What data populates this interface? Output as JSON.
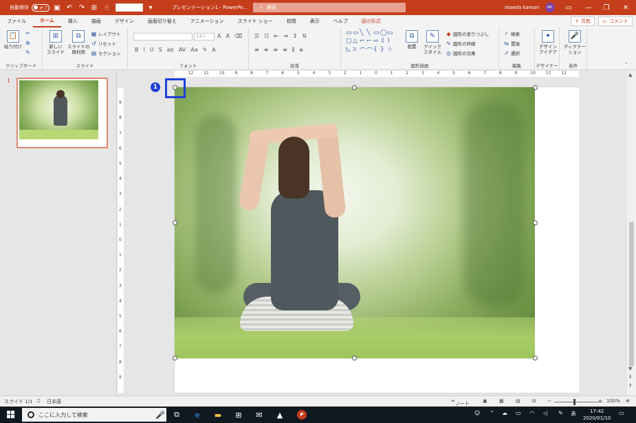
{
  "titlebar": {
    "autosave_label": "自動保存",
    "autosave_state": "オフ",
    "doc_title": "プレゼンテーション1 - PowerPo...",
    "search_placeholder": "検索",
    "user_name": "maeda kamari",
    "user_initials": "MK"
  },
  "tabs": [
    "ファイル",
    "ホーム",
    "挿入",
    "描画",
    "デザイン",
    "画面切り替え",
    "アニメーション",
    "スライド ショー",
    "校閲",
    "表示",
    "ヘルプ",
    "図の形式"
  ],
  "active_tab": "ホーム",
  "share": {
    "share_label": "共有",
    "comment_label": "コメント"
  },
  "ribbon": {
    "clipboard": {
      "group": "クリップボード",
      "paste": "貼り付け"
    },
    "slides": {
      "group": "スライド",
      "new_slide": "新しい\nスライド",
      "reuse": "スライドの\n再利用",
      "layout": "レイアウト",
      "reset": "リセット",
      "section": "セクション"
    },
    "font": {
      "group": "フォント",
      "size": "24+"
    },
    "paragraph": {
      "group": "段落"
    },
    "drawing": {
      "group": "図形描画",
      "arrange": "配置",
      "quick_style": "クイック\nスタイル",
      "fill": "図形の塗りつぶし",
      "outline": "図形の枠線",
      "effect": "図形の効果"
    },
    "editing": {
      "group": "編集",
      "find": "検索",
      "replace": "置換",
      "select": "選択"
    },
    "designer": {
      "group": "デザイナー",
      "ideas": "デザイン\nアイデア"
    },
    "voice": {
      "group": "音声",
      "dictate": "ディクテー\nション"
    }
  },
  "thumbnail": {
    "number": "1"
  },
  "callout": {
    "number": "1"
  },
  "ruler": {
    "h_ticks": [
      "12",
      "11",
      "10",
      "9",
      "8",
      "7",
      "6",
      "5",
      "4",
      "3",
      "2",
      "1",
      "0",
      "1",
      "2",
      "3",
      "4",
      "5",
      "6",
      "7",
      "8",
      "9",
      "10",
      "11",
      "12"
    ],
    "v_ticks": [
      "9",
      "8",
      "7",
      "6",
      "5",
      "4",
      "3",
      "2",
      "1",
      "0",
      "1",
      "2",
      "3",
      "4",
      "5",
      "6",
      "7",
      "8",
      "9"
    ]
  },
  "status": {
    "slide_info": "スライド 1/1",
    "language": "日本語",
    "notes": "ノート",
    "zoom": "100%"
  },
  "taskbar": {
    "search_placeholder": "ここに入力して検索",
    "ime": "あ",
    "time": "17:42",
    "date": "2020/01/10"
  },
  "colors": {
    "accent": "#c43e1c",
    "callout": "#1f3fd6"
  }
}
